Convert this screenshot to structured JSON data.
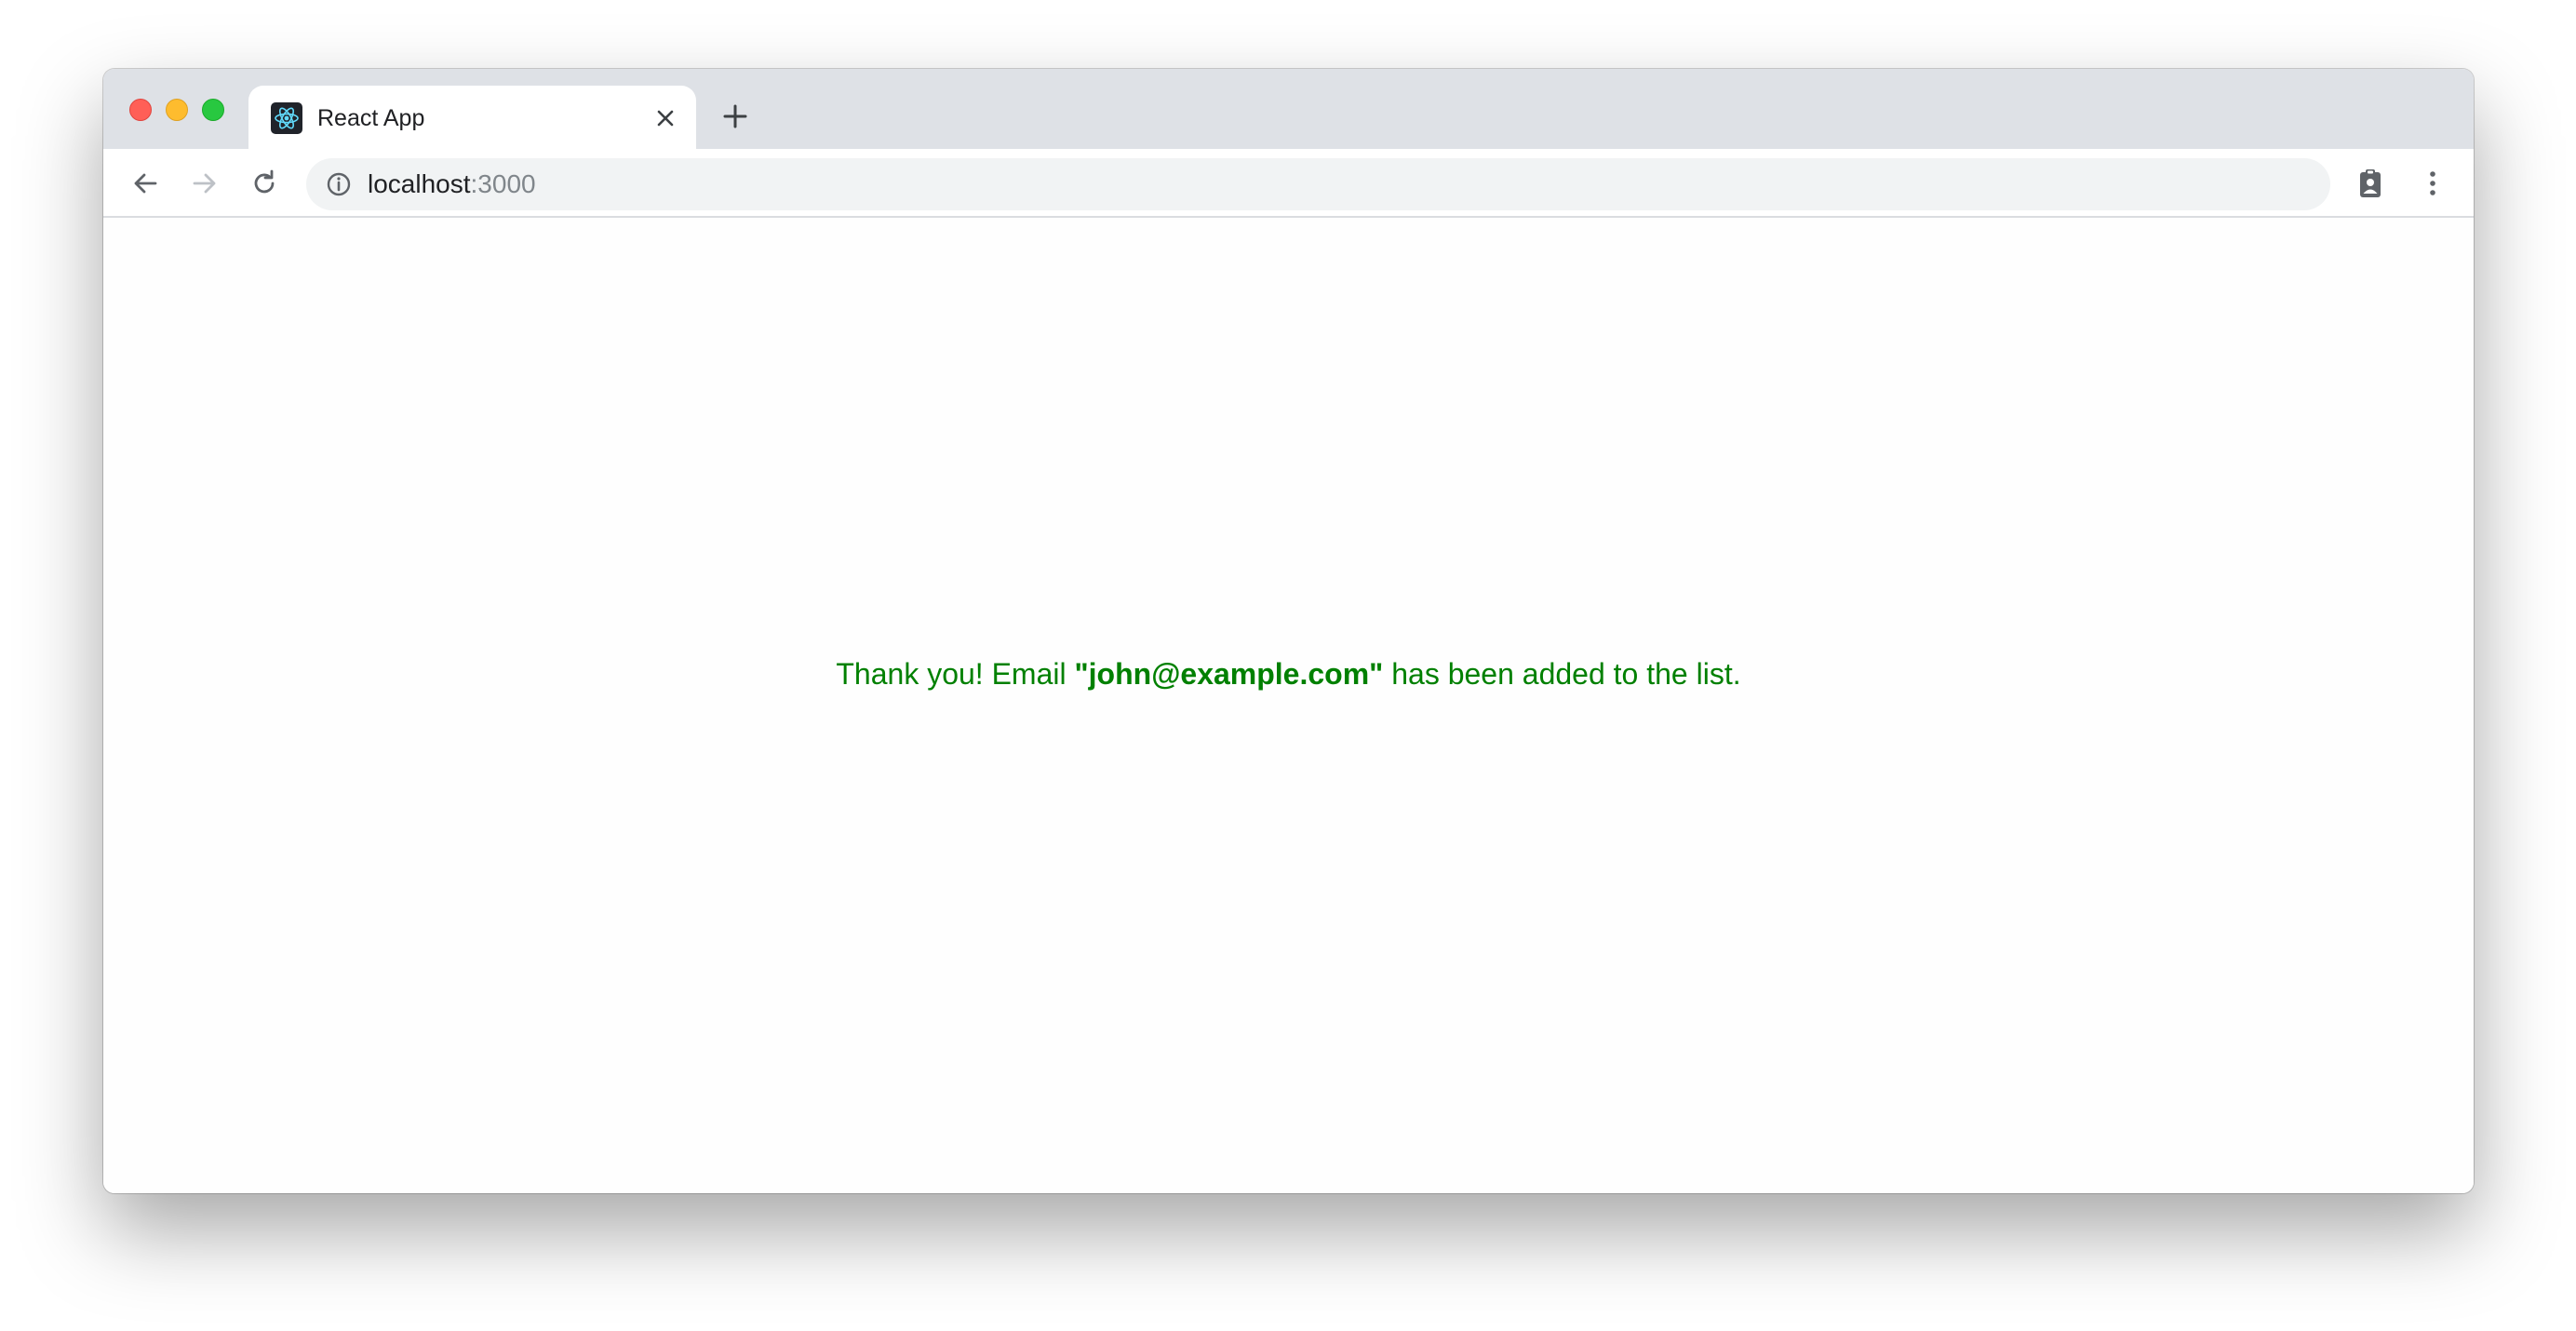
{
  "browser": {
    "tab": {
      "title": "React App",
      "favicon": "react-logo-icon"
    },
    "address_bar": {
      "host": "localhost",
      "port": ":3000"
    },
    "icons": {
      "back": "arrow-left-icon",
      "forward": "arrow-right-icon",
      "reload": "reload-icon",
      "info": "info-icon",
      "extension": "clipboard-person-icon",
      "menu": "kebab-menu-icon",
      "close_tab": "close-icon",
      "new_tab": "plus-icon"
    }
  },
  "page": {
    "message": {
      "before": "Thank you! Email ",
      "email": "\"john@example.com\"",
      "after": " has been added to the list."
    }
  },
  "colors": {
    "message": "#008000",
    "titlebar": "#dee1e6",
    "omnibox": "#f1f3f4"
  }
}
